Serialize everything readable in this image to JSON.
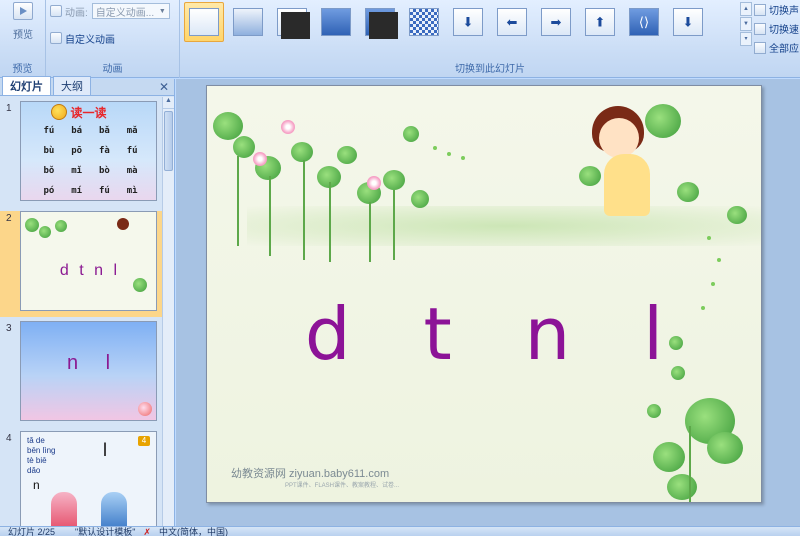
{
  "ribbon": {
    "preview": {
      "label": "预览",
      "group_label": "预览"
    },
    "animation": {
      "anim_label": "动画:",
      "anim_value": "自定义动画...",
      "custom_anim_label": "自定义动画",
      "group_label": "动画"
    },
    "transition": {
      "group_label": "切换到此幻灯片",
      "options": [
        "切换声",
        "切换速",
        "全部应"
      ]
    }
  },
  "leftpane": {
    "tabs": [
      "幻灯片",
      "大纲"
    ],
    "close_glyph": "✕",
    "slides": [
      {
        "number": "1",
        "title": "读一读",
        "syllables": [
          "fú",
          "bá",
          "bǎ",
          "mǎ",
          "bù",
          "pō",
          "fà",
          "fú",
          "bǒ",
          "mǐ",
          "bò",
          "mà",
          "pó",
          "mí",
          "fú",
          "mì"
        ]
      },
      {
        "number": "2",
        "letters": "d t n l"
      },
      {
        "number": "3",
        "letters": "n  l"
      },
      {
        "number": "4",
        "badge": "4",
        "lines": [
          "tǎ de",
          "bēn lìng",
          "tè biē",
          "dǎo"
        ],
        "big_letter": "l",
        "small_letter": "n"
      }
    ]
  },
  "slide": {
    "letters": "d t n l",
    "footer_main": "幼教资源网 ziyuan.baby611.com",
    "footer_sub": "PPT课件、FLASH课件、教案教程、试卷..."
  },
  "status": {
    "slide_count": "幻灯片 2/25",
    "theme": "\"默认设计模板\"",
    "language": "中文(简体，中国)"
  },
  "colors": {
    "ribbon_bg": "#c9dcf5",
    "selected_slide": "#fcd68a",
    "letters_purple": "#8c1397",
    "slide_bg": "#f4f7ea"
  }
}
